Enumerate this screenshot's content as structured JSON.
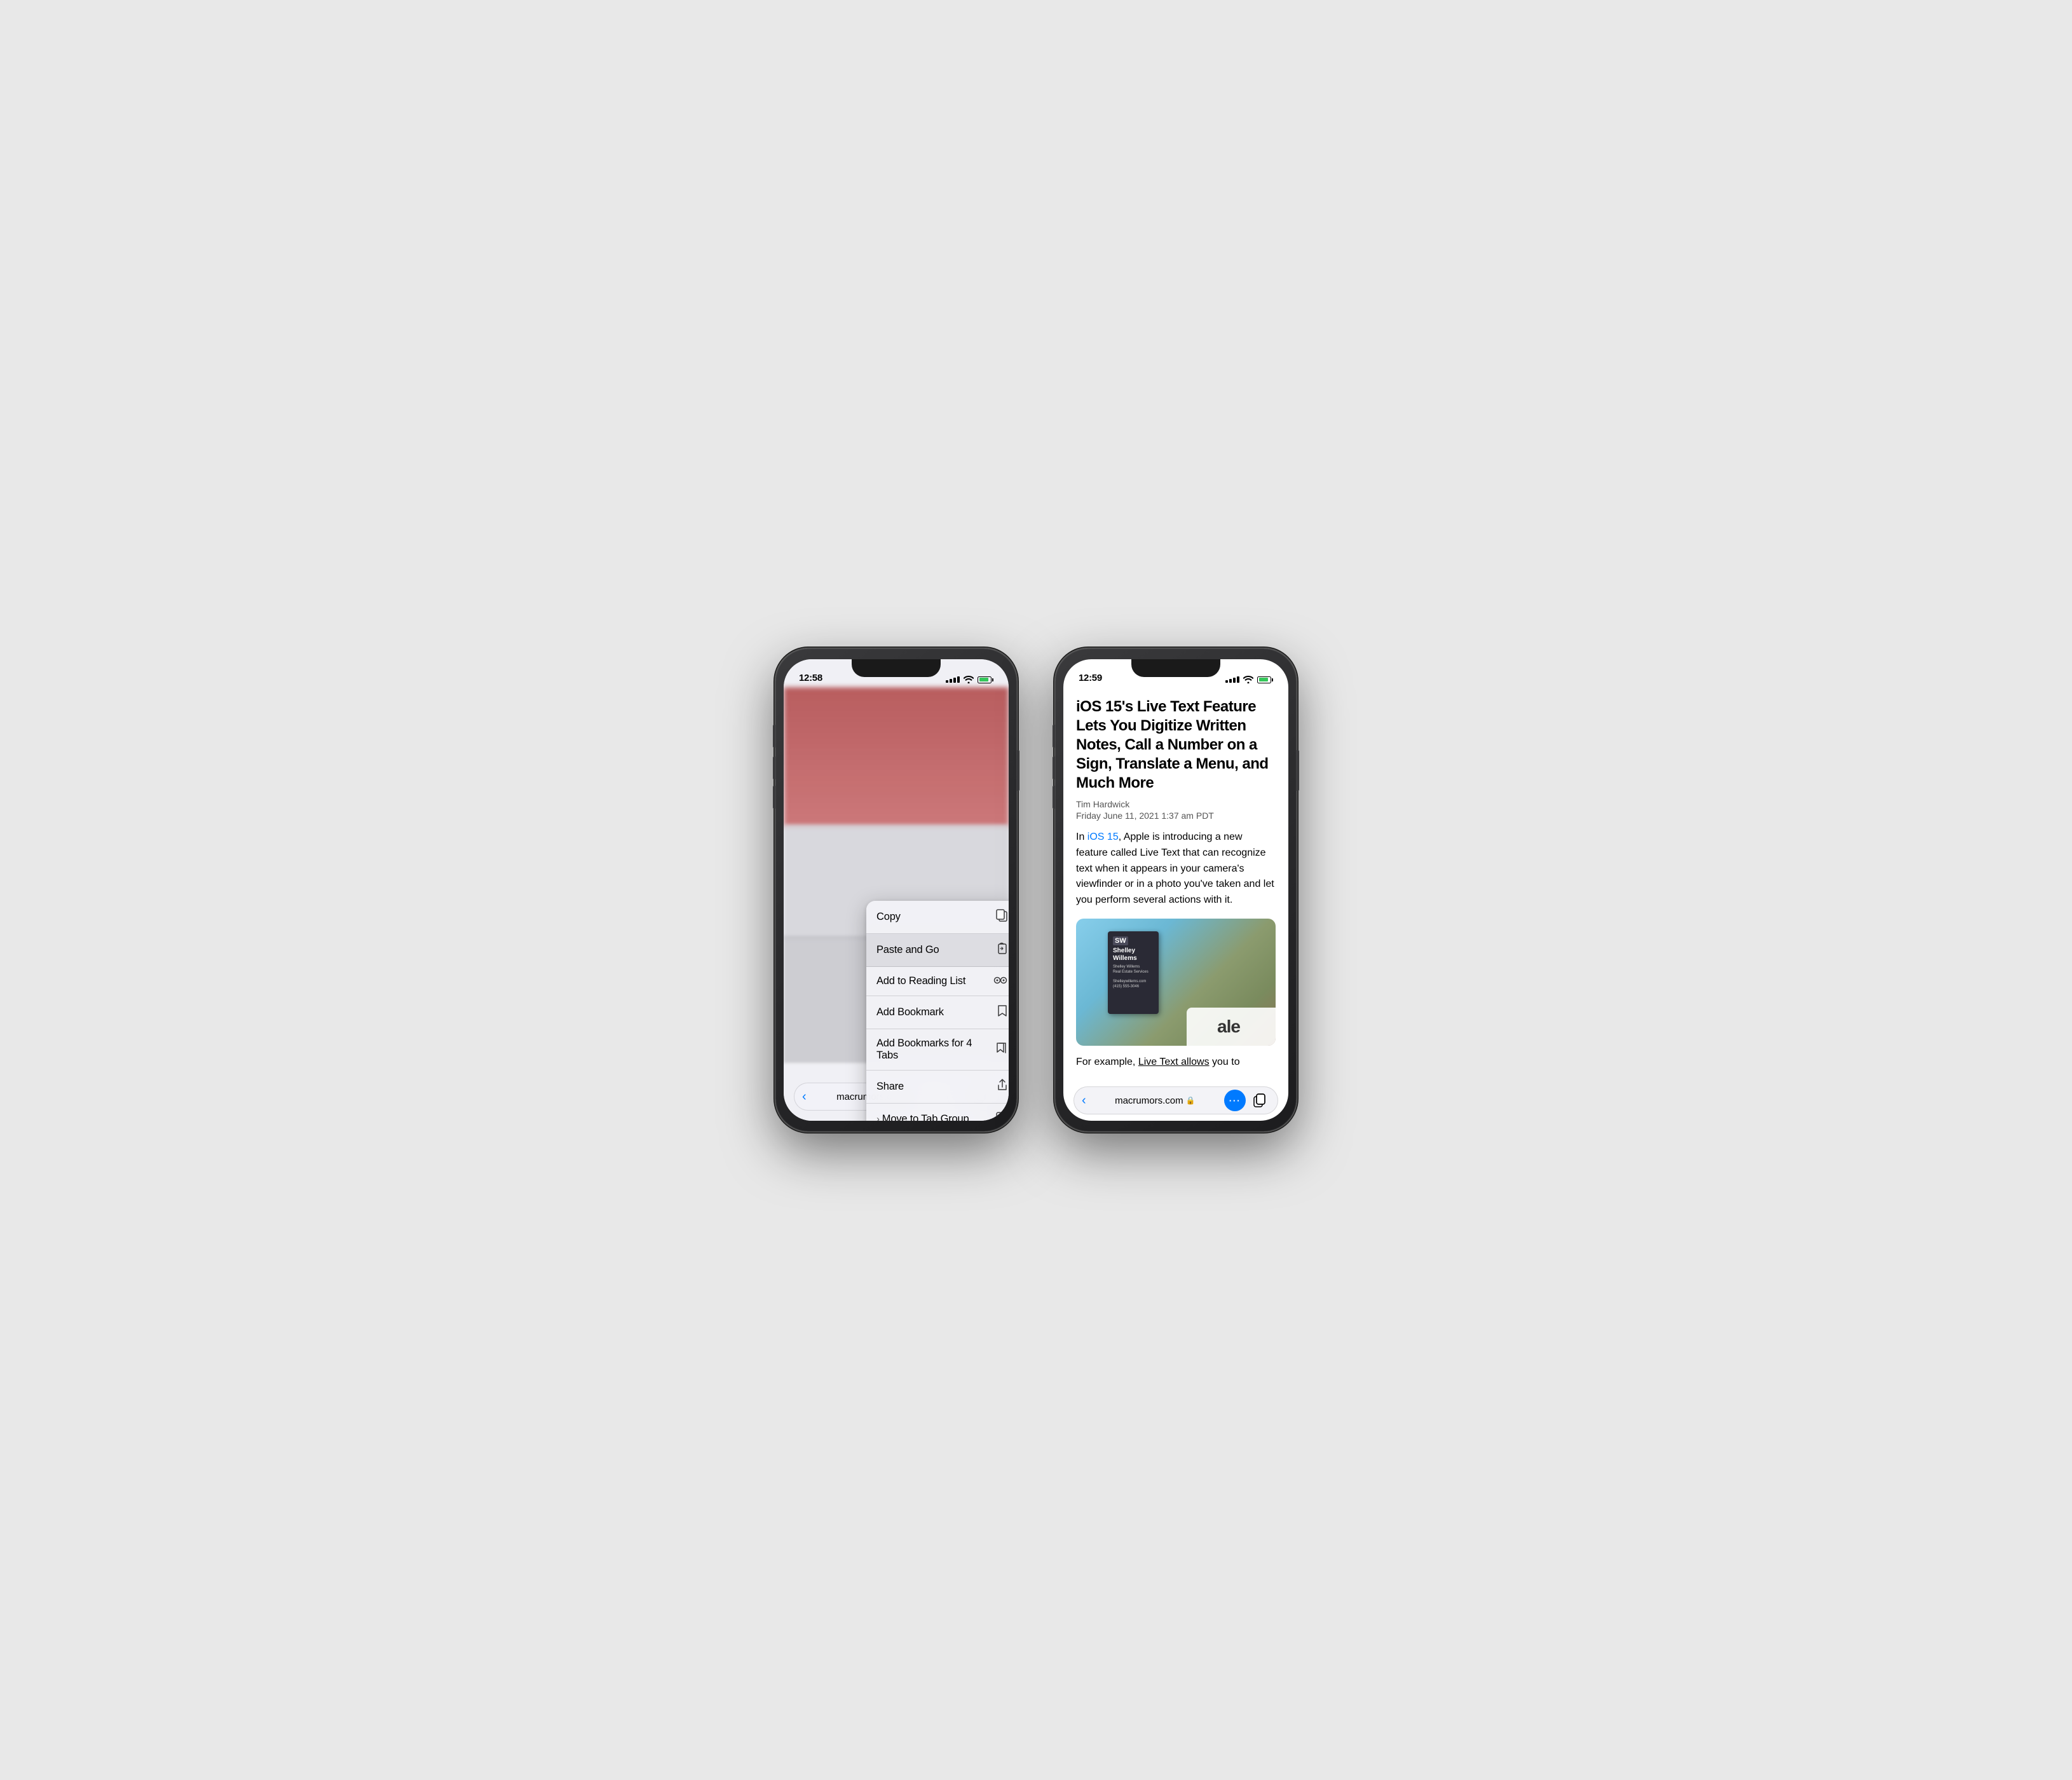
{
  "phone1": {
    "status": {
      "time": "12:58"
    },
    "context_menu": {
      "items": [
        {
          "id": "copy",
          "label": "Copy",
          "icon": "📋"
        },
        {
          "id": "paste-go",
          "label": "Paste and Go",
          "icon": "📋"
        },
        {
          "id": "reading-list",
          "label": "Add to Reading List",
          "icon": "👓"
        },
        {
          "id": "bookmark",
          "label": "Add Bookmark",
          "icon": "📖"
        },
        {
          "id": "bookmark-tabs",
          "label": "Add Bookmarks for 4 Tabs",
          "icon": "📖"
        },
        {
          "id": "share",
          "label": "Share",
          "icon": "⬆"
        },
        {
          "id": "tab-group",
          "label": "Move to Tab Group",
          "icon": "🔲",
          "arrow": true
        }
      ]
    },
    "address_bar": {
      "url": "macrumors.com",
      "back_label": "‹"
    }
  },
  "phone2": {
    "status": {
      "time": "12:59"
    },
    "article": {
      "title": "iOS 15's Live Text Feature Lets You Digitize Written Notes, Call a Number on a Sign, Translate a Menu, and Much More",
      "author": "Tim Hardwick",
      "date": "Friday June 11, 2021 1:37 am PDT",
      "intro_before": "In ",
      "intro_link": "iOS 15",
      "intro_after": ", Apple is introducing a new feature called Live Text that can recognize text when it appears in your camera's viewfinder or in a photo you've taken and let you perform several actions with it.",
      "footer_before": "For example, ",
      "footer_underline": "Live Text allows",
      "footer_after": " you to"
    },
    "address_bar": {
      "url": "macrumors.com",
      "back_label": "‹"
    }
  }
}
